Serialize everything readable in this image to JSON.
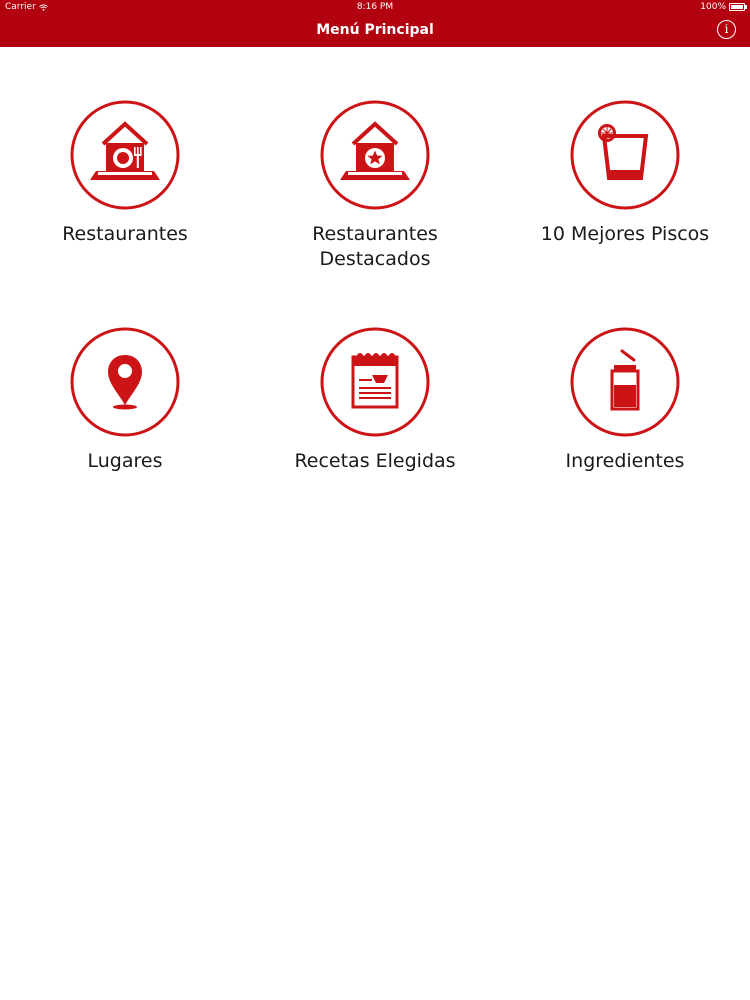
{
  "status_bar": {
    "carrier": "Carrier",
    "time": "8:16 PM",
    "battery": "100%"
  },
  "nav": {
    "title": "Menú Principal",
    "info_label": "i"
  },
  "colors": {
    "brand_red": "#b2010f",
    "icon_red": "#cc1417"
  },
  "menu": [
    {
      "label": "Restaurantes",
      "icon": "restaurant-icon"
    },
    {
      "label": "Restaurantes Destacados",
      "icon": "featured-restaurant-icon"
    },
    {
      "label": "10 Mejores Piscos",
      "icon": "pisco-glass-icon"
    },
    {
      "label": "Lugares",
      "icon": "location-pin-icon"
    },
    {
      "label": "Recetas Elegidas",
      "icon": "recipe-book-icon"
    },
    {
      "label": "Ingredientes",
      "icon": "shaker-icon"
    }
  ]
}
